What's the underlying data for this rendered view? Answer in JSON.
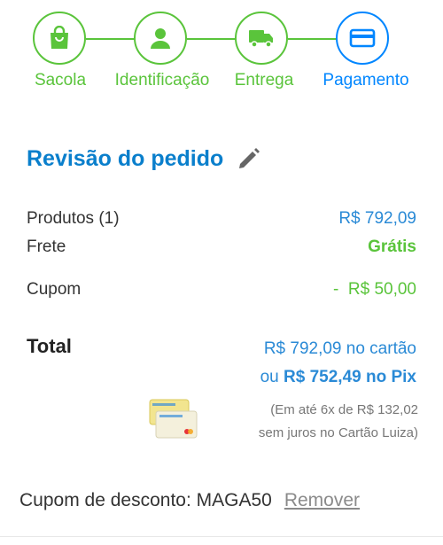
{
  "colors": {
    "accent_green": "#5ac43b",
    "accent_blue": "#0086ff",
    "title_blue": "#0a7fcc"
  },
  "stepper": {
    "steps": [
      {
        "label": "Sacola",
        "icon": "bag-icon",
        "state": "done"
      },
      {
        "label": "Identificação",
        "icon": "user-icon",
        "state": "done"
      },
      {
        "label": "Entrega",
        "icon": "truck-icon",
        "state": "done"
      },
      {
        "label": "Pagamento",
        "icon": "card-icon",
        "state": "active"
      }
    ]
  },
  "review": {
    "title": "Revisão do pedido",
    "edit_icon": "pencil-icon",
    "products_label": "Produtos (1)",
    "products_value": "R$ 792,09",
    "shipping_label": "Frete",
    "shipping_value": "Grátis",
    "coupon_label": "Cupom",
    "coupon_sign": "-",
    "coupon_value": "R$ 50,00",
    "total_label": "Total",
    "total_card": "R$ 792,09 no cartão",
    "total_pix_prefix": "ou ",
    "total_pix": "R$ 752,49 no Pix",
    "installments_line1": "(Em até 6x de R$ 132,02",
    "installments_line2": "sem juros no Cartão Luiza)",
    "card_icon": "luiza-card-icon"
  },
  "coupon_bar": {
    "text": "Cupom de desconto: MAGA50",
    "remove_label": "Remover"
  }
}
